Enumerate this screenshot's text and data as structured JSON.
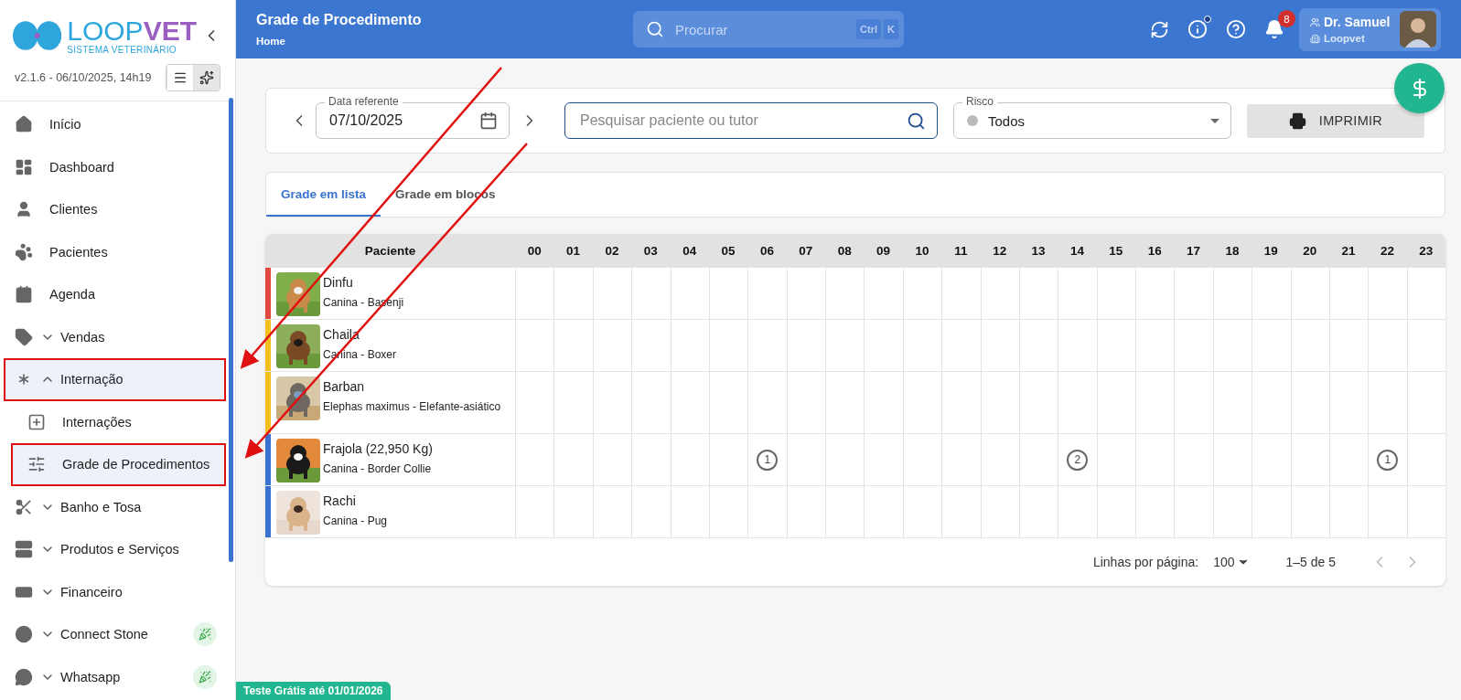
{
  "sidebar": {
    "brand_primary": "LOOP",
    "brand_secondary": "VET",
    "tagline": "SISTEMA VETERINÁRIO",
    "version": "v2.1.6 - 06/10/2025, 14h19",
    "view_toggle": [
      {
        "selected": false
      },
      {
        "selected": true
      }
    ],
    "items": [
      {
        "label": "Início",
        "kind": "link",
        "selected": false,
        "framed": false
      },
      {
        "label": "Dashboard",
        "kind": "link",
        "selected": false,
        "framed": false
      },
      {
        "label": "Clientes",
        "kind": "link",
        "selected": false,
        "framed": false
      },
      {
        "label": "Pacientes",
        "kind": "link",
        "selected": false,
        "framed": false
      },
      {
        "label": "Agenda",
        "kind": "link",
        "selected": false,
        "framed": false
      },
      {
        "label": "Vendas",
        "kind": "group",
        "expanded": false,
        "selected": false,
        "framed": false,
        "new": false
      },
      {
        "label": "Internação",
        "kind": "group",
        "expanded": true,
        "selected": true,
        "framed": true,
        "new": false,
        "children": [
          {
            "label": "Internações",
            "selected": false,
            "framed": false
          },
          {
            "label": "Grade de Procedimentos",
            "selected": true,
            "framed": true
          }
        ]
      },
      {
        "label": "Banho e Tosa",
        "kind": "group",
        "expanded": false,
        "selected": false,
        "framed": false,
        "new": false
      },
      {
        "label": "Produtos e Serviços",
        "kind": "group",
        "expanded": false,
        "selected": false,
        "framed": false,
        "new": false
      },
      {
        "label": "Financeiro",
        "kind": "group",
        "expanded": false,
        "selected": false,
        "framed": false,
        "new": false
      },
      {
        "label": "Connect Stone",
        "kind": "group",
        "expanded": false,
        "selected": false,
        "framed": false,
        "new": true
      },
      {
        "label": "Whatsapp",
        "kind": "group",
        "expanded": false,
        "selected": false,
        "framed": false,
        "new": true
      }
    ]
  },
  "header": {
    "title": "Grade de Procedimento",
    "breadcrumb": "Home",
    "search_placeholder": "Procurar",
    "shortcut": [
      "Ctrl",
      "K"
    ],
    "info_dot": true,
    "notifications": "8",
    "user": "Dr. Samuel",
    "organization": "Loopvet"
  },
  "filters": {
    "date_label": "Data referente",
    "date": "07/10/2025",
    "search_placeholder": "Pesquisar paciente ou tutor",
    "risk_label": "Risco",
    "risk": "Todos",
    "print": "IMPRIMIR"
  },
  "tabs": [
    {
      "label": "Grade em lista",
      "selected": true
    },
    {
      "label": "Grade em blocos",
      "selected": false
    }
  ],
  "table": {
    "patient_header": "Paciente",
    "hours": [
      "00",
      "01",
      "02",
      "03",
      "04",
      "05",
      "06",
      "07",
      "08",
      "09",
      "10",
      "11",
      "12",
      "13",
      "14",
      "15",
      "16",
      "17",
      "18",
      "19",
      "20",
      "21",
      "22",
      "23"
    ],
    "rows": [
      {
        "name": "Dinfu",
        "species": "Canina - Basenji",
        "color": "#e0483e",
        "slots": [
          {
            "filled": false
          },
          {
            "filled": false
          },
          {
            "filled": false
          },
          {
            "filled": false
          },
          {
            "filled": false
          },
          {
            "filled": false
          },
          {
            "filled": false
          },
          {
            "filled": false
          },
          {
            "filled": false
          },
          {
            "filled": false
          },
          {
            "filled": false
          },
          {
            "filled": false
          },
          {
            "filled": false
          },
          {
            "filled": false
          },
          {
            "filled": false
          },
          {
            "filled": false
          },
          {
            "filled": false
          },
          {
            "filled": false
          },
          {
            "filled": false
          },
          {
            "filled": false
          },
          {
            "filled": false
          },
          {
            "filled": false
          },
          {
            "filled": false
          },
          {
            "filled": false
          }
        ]
      },
      {
        "name": "Chaila",
        "species": "Canina - Boxer",
        "color": "#f2c01e",
        "slots": [
          {
            "filled": false
          },
          {
            "filled": false
          },
          {
            "filled": false
          },
          {
            "filled": false
          },
          {
            "filled": false
          },
          {
            "filled": false
          },
          {
            "filled": false
          },
          {
            "filled": false
          },
          {
            "filled": false
          },
          {
            "filled": false
          },
          {
            "filled": false
          },
          {
            "filled": false
          },
          {
            "filled": false
          },
          {
            "filled": false
          },
          {
            "filled": false
          },
          {
            "filled": false
          },
          {
            "filled": false
          },
          {
            "filled": false
          },
          {
            "filled": false
          },
          {
            "filled": false
          },
          {
            "filled": false
          },
          {
            "filled": false
          },
          {
            "filled": false
          },
          {
            "filled": false
          }
        ]
      },
      {
        "name": "Barban",
        "species": "Elephas maximus - Elefante-asiático",
        "color": "#f2c01e",
        "slots": [
          {
            "filled": false
          },
          {
            "filled": false
          },
          {
            "filled": false
          },
          {
            "filled": false
          },
          {
            "filled": false
          },
          {
            "filled": false
          },
          {
            "filled": false
          },
          {
            "filled": false
          },
          {
            "filled": false
          },
          {
            "filled": false
          },
          {
            "filled": false
          },
          {
            "filled": false
          },
          {
            "filled": false
          },
          {
            "filled": false
          },
          {
            "filled": false
          },
          {
            "filled": false
          },
          {
            "filled": false
          },
          {
            "filled": false
          },
          {
            "filled": false
          },
          {
            "filled": false
          },
          {
            "filled": false
          },
          {
            "filled": false
          },
          {
            "filled": false
          },
          {
            "filled": false
          }
        ]
      },
      {
        "name": "Frajola (22,950 Kg)",
        "species": "Canina - Border Collie",
        "color": "#3a72d0",
        "slots": [
          {
            "filled": false
          },
          {
            "filled": false
          },
          {
            "filled": false
          },
          {
            "filled": false
          },
          {
            "filled": false
          },
          {
            "filled": false
          },
          {
            "filled": true,
            "count": "1"
          },
          {
            "filled": false
          },
          {
            "filled": false
          },
          {
            "filled": false
          },
          {
            "filled": false
          },
          {
            "filled": false
          },
          {
            "filled": false
          },
          {
            "filled": false
          },
          {
            "filled": true,
            "count": "2"
          },
          {
            "filled": false
          },
          {
            "filled": false
          },
          {
            "filled": false
          },
          {
            "filled": false
          },
          {
            "filled": false
          },
          {
            "filled": false
          },
          {
            "filled": false
          },
          {
            "filled": true,
            "count": "1"
          },
          {
            "filled": false
          }
        ]
      },
      {
        "name": "Rachi",
        "species": "Canina - Pug",
        "color": "#3a72d0",
        "slots": [
          {
            "filled": false
          },
          {
            "filled": false
          },
          {
            "filled": false
          },
          {
            "filled": false
          },
          {
            "filled": false
          },
          {
            "filled": false
          },
          {
            "filled": false
          },
          {
            "filled": false
          },
          {
            "filled": false
          },
          {
            "filled": false
          },
          {
            "filled": false
          },
          {
            "filled": false
          },
          {
            "filled": false
          },
          {
            "filled": false
          },
          {
            "filled": false
          },
          {
            "filled": false
          },
          {
            "filled": false
          },
          {
            "filled": false
          },
          {
            "filled": false
          },
          {
            "filled": false
          },
          {
            "filled": false
          },
          {
            "filled": false
          },
          {
            "filled": false
          },
          {
            "filled": false
          }
        ]
      }
    ]
  },
  "pagination": {
    "rows_label": "Linhas por página:",
    "rows_value": "100",
    "range": "1–5 de 5"
  },
  "trial_banner": "Teste Grátis até 01/01/2026"
}
